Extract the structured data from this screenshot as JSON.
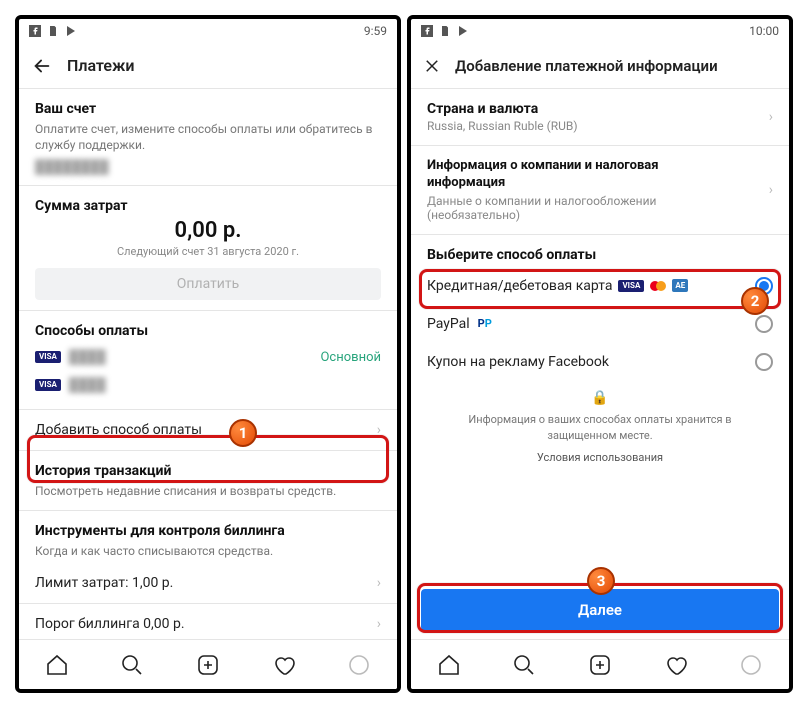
{
  "left": {
    "status_time": "9:59",
    "title": "Платежи",
    "account": {
      "heading": "Ваш счет",
      "desc": "Оплатите счет, измените способы оплаты или обратитесь в службу поддержки.",
      "masked": "████████"
    },
    "spend": {
      "heading": "Сумма затрат",
      "amount": "0,00 р.",
      "next_bill": "Следующий счет 31 августа 2020 г.",
      "pay_label": "Оплатить"
    },
    "pm": {
      "heading": "Способы оплаты",
      "card1_mask": "████",
      "primary": "Основной",
      "card2_mask": "████",
      "add_label": "Добавить способ оплаты"
    },
    "history": {
      "heading": "История транзакций",
      "desc": "Посмотреть недавние списания и возвраты средств."
    },
    "billing": {
      "heading": "Инструменты для контроля биллинга",
      "desc": "Когда и как часто списываются средства.",
      "limit_row": "Лимит затрат: 1,00 р.",
      "threshold_row": "Порог биллинга 0,00 р."
    }
  },
  "right": {
    "status_time": "10:00",
    "title": "Добавление платежной информации",
    "country": {
      "heading": "Страна и валюта",
      "value": "Russia, Russian Ruble (RUB)"
    },
    "business": {
      "heading": "Информация о компании и налоговая информация",
      "desc": "Данные о компании и налогообложении (необязательно)"
    },
    "choose": {
      "heading": "Выберите способ оплаты",
      "card": "Кредитная/дебетовая карта",
      "paypal": "PayPal",
      "coupon": "Купон на рекламу Facebook"
    },
    "secure": "Информация о ваших способах оплаты хранится в защищенном месте.",
    "terms": "Условия использования",
    "cta": "Далее"
  }
}
